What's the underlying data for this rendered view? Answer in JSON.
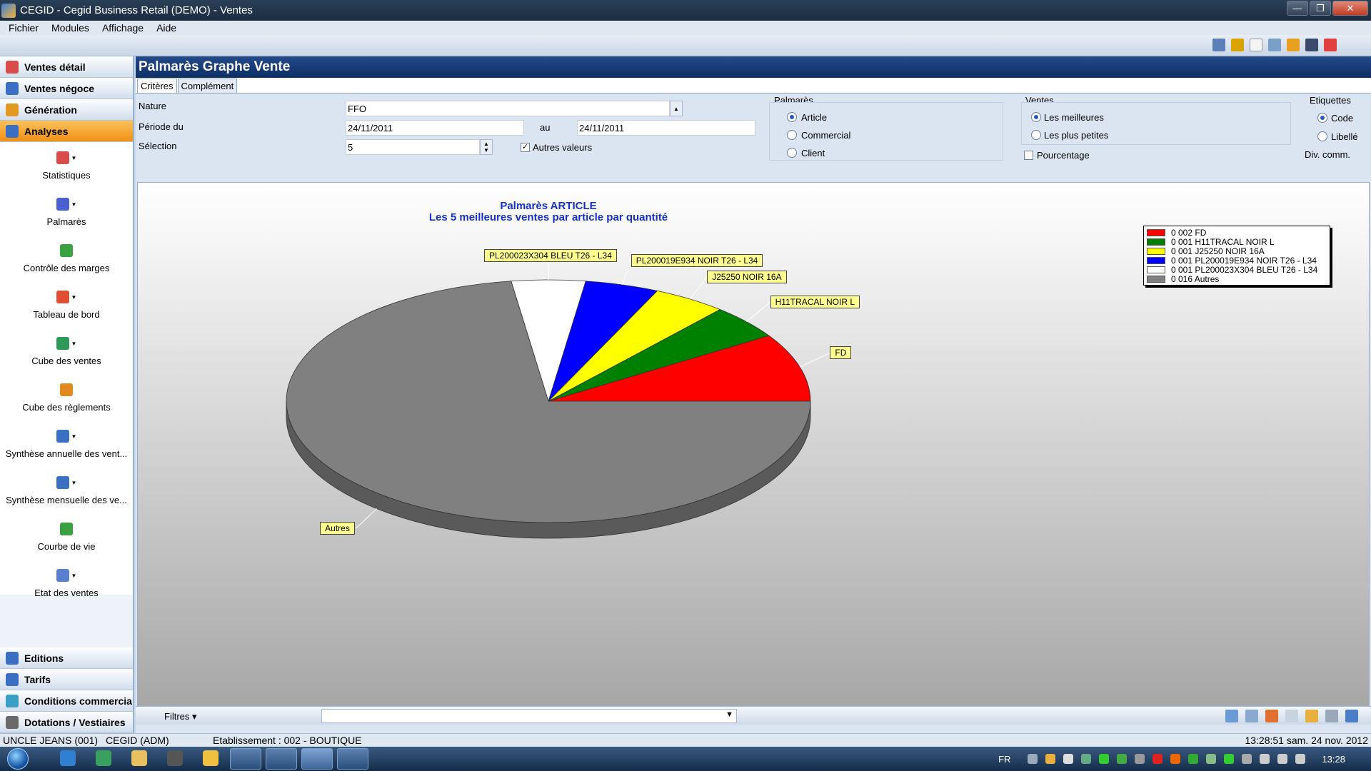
{
  "window": {
    "title": "CEGID - Cegid Business Retail (DEMO) - Ventes",
    "controls": [
      "minimize",
      "restore",
      "close"
    ]
  },
  "menu": [
    "Fichier",
    "Modules",
    "Affichage",
    "Aide"
  ],
  "leftnav": {
    "sections_top": [
      {
        "label": "Ventes détail",
        "icon": "sales-detail-icon",
        "color": "#d94c4c"
      },
      {
        "label": "Ventes négoce",
        "icon": "sales-trade-icon",
        "color": "#3a6fc4"
      },
      {
        "label": "Génération",
        "icon": "generation-icon",
        "color": "#e09a20"
      },
      {
        "label": "Analyses",
        "icon": "analyses-icon",
        "color": "#3a6fc4",
        "active": true
      }
    ],
    "items": [
      {
        "label": "Statistiques",
        "icon": "statistics-icon",
        "color": "#d94c4c",
        "dropdown": true
      },
      {
        "label": "Palmarès",
        "icon": "pie-chart-icon",
        "color": "#4a5fd0",
        "dropdown": true
      },
      {
        "label": "Contrôle des marges",
        "icon": "margin-control-icon",
        "color": "#3aa040",
        "dropdown": false
      },
      {
        "label": "Tableau de bord",
        "icon": "dashboard-icon",
        "color": "#e05030",
        "dropdown": true
      },
      {
        "label": "Cube des ventes",
        "icon": "sales-cube-icon",
        "color": "#2f9a58",
        "dropdown": true
      },
      {
        "label": "Cube des règlements",
        "icon": "payments-cube-icon",
        "color": "#e08a20",
        "dropdown": false
      },
      {
        "label": "Synthèse annuelle des vent...",
        "icon": "annual-summary-icon",
        "color": "#3a6fc4",
        "dropdown": true
      },
      {
        "label": "Synthèse mensuelle des ve...",
        "icon": "monthly-summary-icon",
        "color": "#3a6fc4",
        "dropdown": true
      },
      {
        "label": "Courbe de vie",
        "icon": "life-curve-icon",
        "color": "#3aa040",
        "dropdown": false
      },
      {
        "label": "Etat des ventes",
        "icon": "sales-report-icon",
        "color": "#5a7fd0",
        "dropdown": true
      }
    ],
    "sections_bottom": [
      {
        "label": "Editions",
        "icon": "editions-icon",
        "color": "#3a6fc4"
      },
      {
        "label": "Tarifs",
        "icon": "prices-icon",
        "color": "#3a6fc4"
      },
      {
        "label": "Conditions commercia",
        "icon": "commercial-conditions-icon",
        "color": "#3a9fc4"
      },
      {
        "label": "Dotations / Vestiaires",
        "icon": "allocations-icon",
        "color": "#6a6a6a"
      }
    ]
  },
  "panel": {
    "title": "Palmarès Graphe Vente",
    "tabs": [
      "Critères",
      "Complément"
    ],
    "active_tab": "Critères"
  },
  "criteria": {
    "nature_label": "Nature",
    "nature_value": "FFO",
    "periode_label": "Période du",
    "date_from": "24/11/2011",
    "au_label": "au",
    "date_to": "24/11/2011",
    "selection_label": "Sélection",
    "selection_value": "5",
    "autres_valeurs_label": "Autres valeurs",
    "autres_valeurs_checked": true,
    "palmares_title": "Palmarès",
    "palmares_options": [
      "Article",
      "Commercial",
      "Client"
    ],
    "palmares_selected": "Article",
    "ventes_title": "Ventes",
    "ventes_options": [
      "Les meilleures",
      "Les plus petites"
    ],
    "ventes_selected": "Les meilleures",
    "pourcentage_label": "Pourcentage",
    "pourcentage_checked": false,
    "etiquettes_title": "Etiquettes",
    "etiquettes_options": [
      "Code",
      "Libellé"
    ],
    "etiquettes_selected": "Code",
    "div_comm_label": "Div. comm."
  },
  "chart_data": {
    "type": "pie",
    "title": "Palmarès ARTICLE",
    "subtitle": "Les 5 meilleures ventes  par article  par quantité",
    "legend_position": "top-right",
    "slices": [
      {
        "label": "FD",
        "legend": "0 002 FD",
        "value": 2,
        "color": "#ff0000"
      },
      {
        "label": "H11TRACAL NOIR L",
        "legend": "0 001 H11TRACAL NOIR L",
        "value": 1,
        "color": "#008000"
      },
      {
        "label": "J25250 NOIR 16A",
        "legend": "0 001 J25250 NOIR 16A",
        "value": 1,
        "color": "#ffff00"
      },
      {
        "label": "PL200019E934 NOIR T26 - L34",
        "legend": "0 001 PL200019E934 NOIR T26 - L34",
        "value": 1,
        "color": "#0000ff"
      },
      {
        "label": "PL200023X304 BLEU T26 - L34",
        "legend": "0 001 PL200023X304 BLEU T26 - L34",
        "value": 1,
        "color": "#ffffff"
      },
      {
        "label": "Autres",
        "legend": "0 016 Autres",
        "value": 16,
        "color": "#808080"
      }
    ]
  },
  "filterbar": {
    "filtres_label": "Filtres",
    "filter_value": ""
  },
  "status": {
    "company": "UNCLE JEANS (001)",
    "user": "CEGID (ADM)",
    "etablissement": "Etablissement : 002 - BOUTIQUE",
    "datetime": "13:28:51 sam. 24 nov. 2012"
  },
  "taskbar": {
    "language": "FR",
    "clock": "13:28"
  }
}
